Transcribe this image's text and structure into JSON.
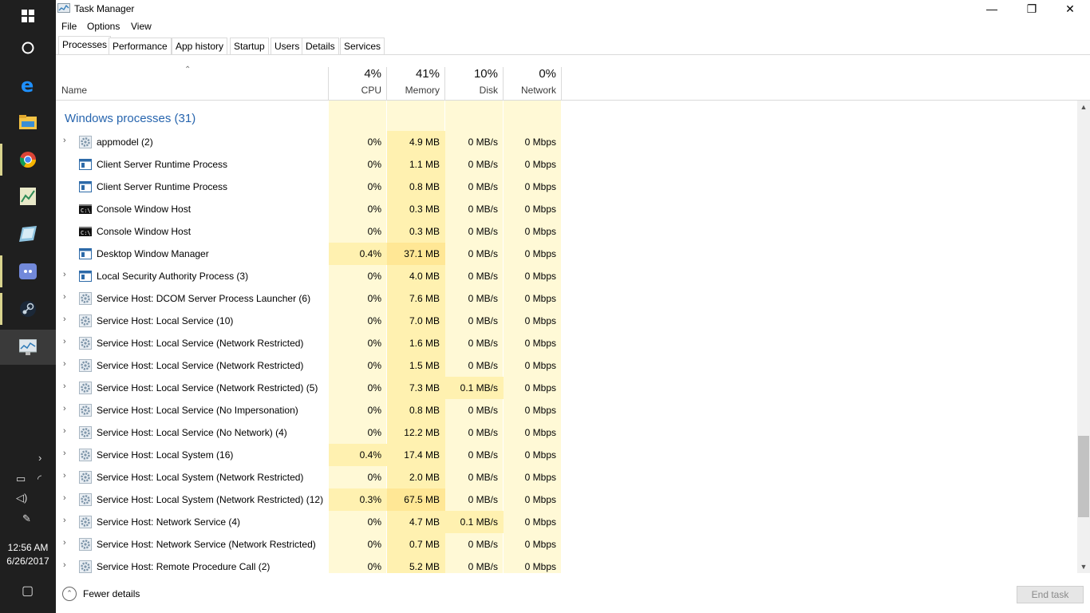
{
  "taskbar": {
    "clock_time": "12:56 AM",
    "clock_date": "6/26/2017"
  },
  "window": {
    "title": "Task Manager",
    "controls": {
      "minimize": "—",
      "maximize": "❐",
      "close": "✕"
    }
  },
  "menu": [
    "File",
    "Options",
    "View"
  ],
  "tabs": [
    "Processes",
    "Performance",
    "App history",
    "Startup",
    "Users",
    "Details",
    "Services"
  ],
  "selected_tab": "Processes",
  "columns": {
    "name_label": "Name",
    "cpu": {
      "percent": "4%",
      "label": "CPU"
    },
    "memory": {
      "percent": "41%",
      "label": "Memory"
    },
    "disk": {
      "percent": "10%",
      "label": "Disk"
    },
    "network": {
      "percent": "0%",
      "label": "Network"
    }
  },
  "group_title": "Windows processes (31)",
  "processes": [
    {
      "name": "appmodel (2)",
      "expandable": true,
      "icon": "gear-icon",
      "cpu": "0%",
      "memory": "4.9 MB",
      "disk": "0 MB/s",
      "network": "0 Mbps"
    },
    {
      "name": "Client Server Runtime Process",
      "expandable": false,
      "icon": "window-icon",
      "cpu": "0%",
      "memory": "1.1 MB",
      "disk": "0 MB/s",
      "network": "0 Mbps"
    },
    {
      "name": "Client Server Runtime Process",
      "expandable": false,
      "icon": "window-icon",
      "cpu": "0%",
      "memory": "0.8 MB",
      "disk": "0 MB/s",
      "network": "0 Mbps"
    },
    {
      "name": "Console Window Host",
      "expandable": false,
      "icon": "console-icon",
      "cpu": "0%",
      "memory": "0.3 MB",
      "disk": "0 MB/s",
      "network": "0 Mbps"
    },
    {
      "name": "Console Window Host",
      "expandable": false,
      "icon": "console-icon",
      "cpu": "0%",
      "memory": "0.3 MB",
      "disk": "0 MB/s",
      "network": "0 Mbps"
    },
    {
      "name": "Desktop Window Manager",
      "expandable": false,
      "icon": "window-icon",
      "cpu": "0.4%",
      "memory": "37.1 MB",
      "disk": "0 MB/s",
      "network": "0 Mbps"
    },
    {
      "name": "Local Security Authority Process (3)",
      "expandable": true,
      "icon": "window-icon",
      "cpu": "0%",
      "memory": "4.0 MB",
      "disk": "0 MB/s",
      "network": "0 Mbps"
    },
    {
      "name": "Service Host: DCOM Server Process Launcher (6)",
      "expandable": true,
      "icon": "gear-icon",
      "cpu": "0%",
      "memory": "7.6 MB",
      "disk": "0 MB/s",
      "network": "0 Mbps"
    },
    {
      "name": "Service Host: Local Service (10)",
      "expandable": true,
      "icon": "gear-icon",
      "cpu": "0%",
      "memory": "7.0 MB",
      "disk": "0 MB/s",
      "network": "0 Mbps"
    },
    {
      "name": "Service Host: Local Service (Network Restricted)",
      "expandable": true,
      "icon": "gear-icon",
      "cpu": "0%",
      "memory": "1.6 MB",
      "disk": "0 MB/s",
      "network": "0 Mbps"
    },
    {
      "name": "Service Host: Local Service (Network Restricted)",
      "expandable": true,
      "icon": "gear-icon",
      "cpu": "0%",
      "memory": "1.5 MB",
      "disk": "0 MB/s",
      "network": "0 Mbps"
    },
    {
      "name": "Service Host: Local Service (Network Restricted) (5)",
      "expandable": true,
      "icon": "gear-icon",
      "cpu": "0%",
      "memory": "7.3 MB",
      "disk": "0.1 MB/s",
      "network": "0 Mbps"
    },
    {
      "name": "Service Host: Local Service (No Impersonation)",
      "expandable": true,
      "icon": "gear-icon",
      "cpu": "0%",
      "memory": "0.8 MB",
      "disk": "0 MB/s",
      "network": "0 Mbps"
    },
    {
      "name": "Service Host: Local Service (No Network) (4)",
      "expandable": true,
      "icon": "gear-icon",
      "cpu": "0%",
      "memory": "12.2 MB",
      "disk": "0 MB/s",
      "network": "0 Mbps"
    },
    {
      "name": "Service Host: Local System (16)",
      "expandable": true,
      "icon": "gear-icon",
      "cpu": "0.4%",
      "memory": "17.4 MB",
      "disk": "0 MB/s",
      "network": "0 Mbps"
    },
    {
      "name": "Service Host: Local System (Network Restricted)",
      "expandable": true,
      "icon": "gear-icon",
      "cpu": "0%",
      "memory": "2.0 MB",
      "disk": "0 MB/s",
      "network": "0 Mbps"
    },
    {
      "name": "Service Host: Local System (Network Restricted) (12)",
      "expandable": true,
      "icon": "gear-icon",
      "cpu": "0.3%",
      "memory": "67.5 MB",
      "disk": "0 MB/s",
      "network": "0 Mbps"
    },
    {
      "name": "Service Host: Network Service (4)",
      "expandable": true,
      "icon": "gear-icon",
      "cpu": "0%",
      "memory": "4.7 MB",
      "disk": "0.1 MB/s",
      "network": "0 Mbps"
    },
    {
      "name": "Service Host: Network Service (Network Restricted)",
      "expandable": true,
      "icon": "gear-icon",
      "cpu": "0%",
      "memory": "0.7 MB",
      "disk": "0 MB/s",
      "network": "0 Mbps"
    },
    {
      "name": "Service Host: Remote Procedure Call (2)",
      "expandable": true,
      "icon": "gear-icon",
      "cpu": "0%",
      "memory": "5.2 MB",
      "disk": "0 MB/s",
      "network": "0 Mbps"
    }
  ],
  "footer": {
    "fewer_details": "Fewer details",
    "end_task": "End task"
  },
  "colors": {
    "cell_light": "#fff9d6",
    "cell_medium": "#fff1b0",
    "cell_strong": "#ffe795",
    "group_title": "#2765ae"
  }
}
